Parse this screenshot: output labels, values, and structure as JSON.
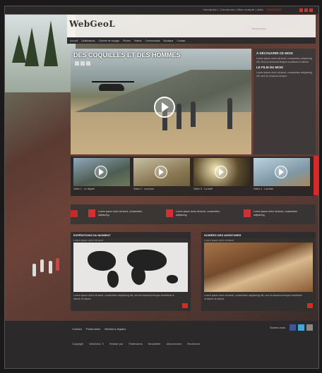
{
  "colors": {
    "accent": "#d22b2b",
    "dark": "#2b292a",
    "panel": "#3c3a3a"
  },
  "topbar": {
    "links": "Inscription / Connexion  |  Mon compte  |  Aide",
    "highlight": "MAGAZINE",
    "extra": "Contact"
  },
  "header": {
    "logo": "WebGeoL",
    "tagline": "Rechercher"
  },
  "nav": {
    "items": [
      "Accueil",
      "Destinations",
      "Carnets de voyage",
      "Photos",
      "Vidéos",
      "Communauté",
      "Boutique",
      "Contact"
    ]
  },
  "hero": {
    "title": "DES COQUILLES ET DES HOMMES",
    "icons": [
      "share-icon",
      "like-icon",
      "tweet-icon"
    ]
  },
  "side": {
    "sections": [
      {
        "title": "À DÉCOUVRIR CE MOIS",
        "text": "Lorem ipsum dolor sit amet, consectetur adipiscing elit. Sed do eiusmod tempor incididunt ut labore."
      },
      {
        "title": "LE FILM DU MOIS",
        "text": "Lorem ipsum dolor sit amet, consectetur adipiscing elit, sed do eiusmod tempor."
      }
    ]
  },
  "thumbs": [
    {
      "caption": "Vidéo 1 · Le départ"
    },
    {
      "caption": "Vidéo 2 · Les lions"
    },
    {
      "caption": "Vidéo 3 · La forêt"
    },
    {
      "caption": "Vidéo 4 · L'arrivée"
    }
  ],
  "news": [
    {
      "text": "Lorem ipsum dolor sit amet, consectetur adipiscing"
    },
    {
      "text": "Lorem ipsum dolor sit amet, consectetur adipiscing"
    },
    {
      "text": "Lorem ipsum dolor sit amet, consectetur adipiscing"
    }
  ],
  "panels": {
    "left": {
      "title": "EXPÉDITIONS DU MOMENT",
      "sub": "Lorem ipsum dolor sit amet",
      "text": "Lorem ipsum dolor sit amet, consectetur adipiscing elit, sed do eiusmod tempor incididunt ut labore et dolore."
    },
    "right": {
      "title": "SOIRÉES DES AVENTURES",
      "sub": "Lorem ipsum dolor sit amet",
      "text": "Lorem ipsum dolor sit amet, consectetur adipiscing elit, sed do eiusmod tempor incididunt ut labore et dolore."
    }
  },
  "footer": {
    "links": [
      "Contact",
      "Partenaires",
      "Mentions légales"
    ],
    "follow": "Suivez-nous",
    "bottom": [
      "Copyright",
      "WebGeoL ©",
      "Réalisé par",
      "Partenaires",
      "Newsletter",
      "Abonnement",
      "Recherche"
    ]
  }
}
